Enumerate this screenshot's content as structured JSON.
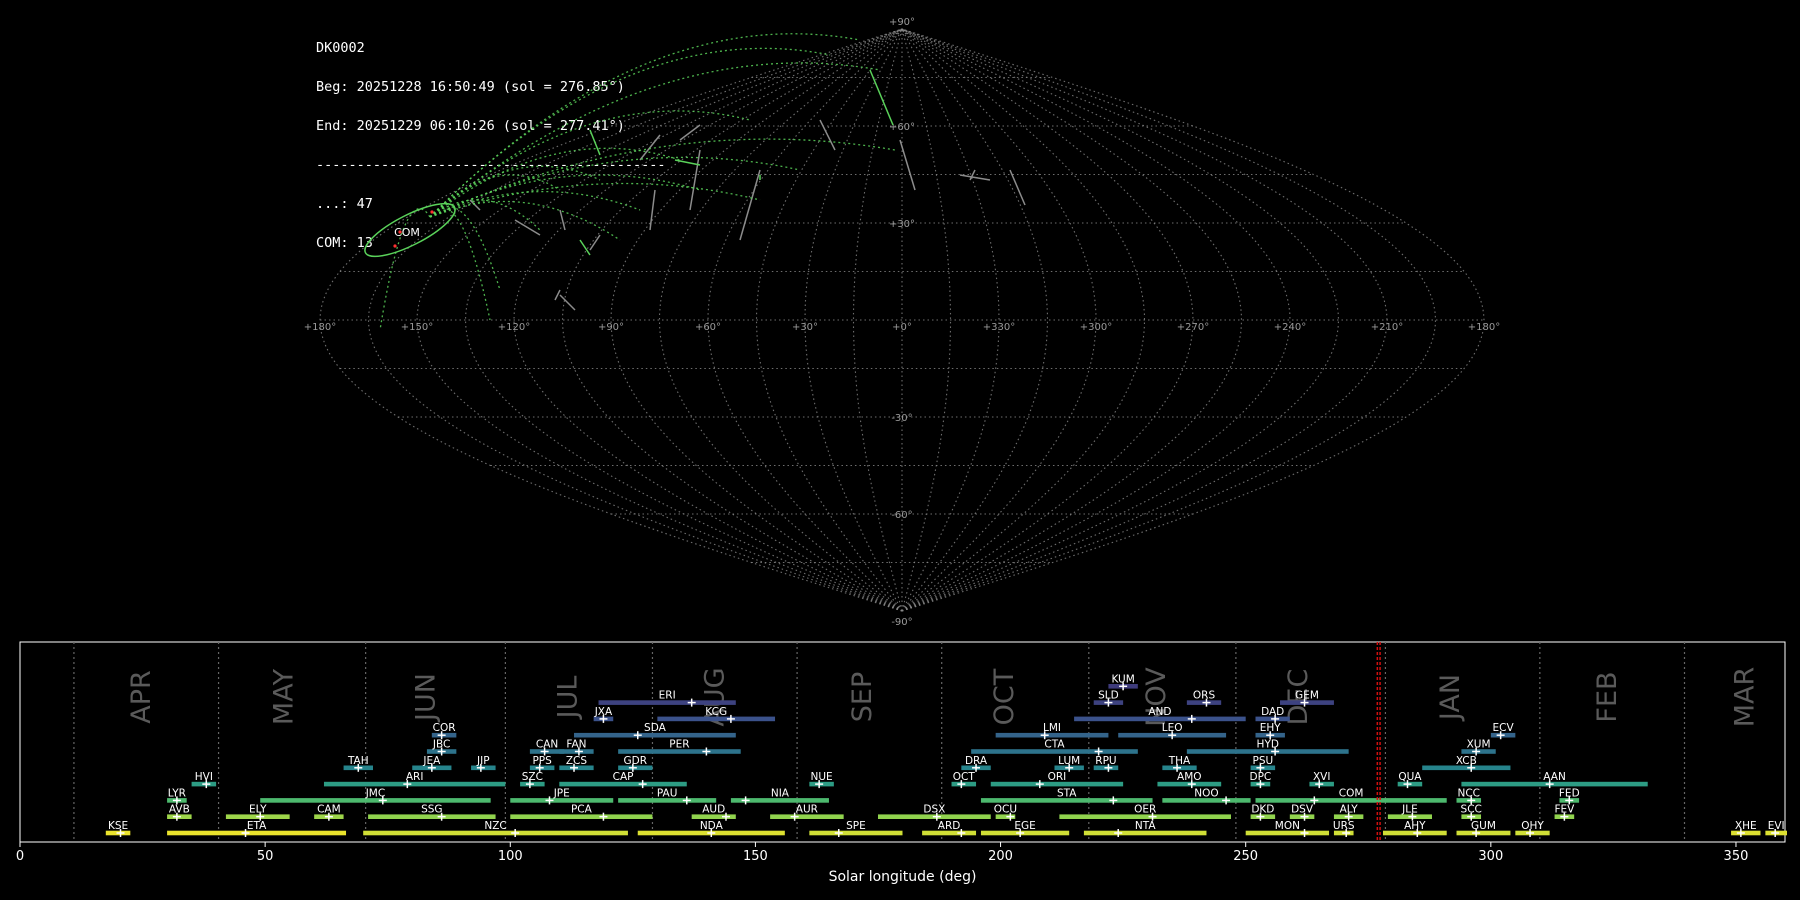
{
  "info": {
    "station": "DK0002",
    "begin": "Beg: 20251228 16:50:49 (sol = 276.85°)",
    "end": "End: 20251229 06:10:26 (sol = 277.41°)",
    "separator": "-------------------------------------------",
    "counts": [
      {
        "label": "...",
        "value": 47
      },
      {
        "label": "COM",
        "value": 13
      }
    ]
  },
  "colors": {
    "background": "#000000",
    "grid": "#8a8a8a",
    "sporadic_track": "#8c8c8c",
    "shower_track": "#5ad25a",
    "radiant_marker": "#ff3030",
    "current_sol_line": "#d01010",
    "month_label": "#5a5a5a",
    "timeline_text": "#ffffff"
  },
  "skymap": {
    "projection": "sinusoidal",
    "lon_tick_labels": [
      "+180°",
      "+150°",
      "+120°",
      "+90°",
      "+60°",
      "+30°",
      "+0°",
      "+330°",
      "+300°",
      "+270°",
      "+240°",
      "+210°",
      "+180°"
    ],
    "lat_tick_labels": [
      "+90°",
      "+60°",
      "+30°",
      "-30°",
      "-60°",
      "-90°"
    ],
    "radiant_label": "COM"
  },
  "chart_data": {
    "type": "gantt",
    "xlabel": "Solar longitude (deg)",
    "xlim": [
      0,
      360
    ],
    "xticks": [
      0,
      50,
      100,
      150,
      200,
      250,
      300,
      350
    ],
    "grid": false,
    "current_sol": [
      276.85,
      277.41
    ],
    "months": [
      {
        "name": "APR",
        "boundary": 11,
        "label_at": 25
      },
      {
        "name": "MAY",
        "boundary": 40.5,
        "label_at": 54
      },
      {
        "name": "JUN",
        "boundary": 70.5,
        "label_at": 83
      },
      {
        "name": "JUL",
        "boundary": 99,
        "label_at": 112
      },
      {
        "name": "AUG",
        "boundary": 129,
        "label_at": 142
      },
      {
        "name": "SEP",
        "boundary": 158.5,
        "label_at": 172
      },
      {
        "name": "OCT",
        "boundary": 188,
        "label_at": 201
      },
      {
        "name": "NOV",
        "boundary": 218,
        "label_at": 232
      },
      {
        "name": "DEC",
        "boundary": 248,
        "label_at": 261
      },
      {
        "name": "JAN",
        "boundary": 278.5,
        "label_at": 292
      },
      {
        "name": "FEB",
        "boundary": 310,
        "label_at": 324
      },
      {
        "name": "MAR",
        "boundary": 339.5,
        "label_at": 352
      }
    ],
    "showers": [
      {
        "code": "KSE",
        "row": 0,
        "start": 17.5,
        "end": 22.5,
        "peak": 20.5,
        "level": 0.97
      },
      {
        "code": "ETA",
        "row": 0,
        "start": 30,
        "end": 66.5,
        "peak": 46,
        "level": 0.97
      },
      {
        "code": "NZC",
        "row": 0,
        "start": 70,
        "end": 124,
        "peak": 101,
        "level": 0.93
      },
      {
        "code": "NDA",
        "row": 0,
        "start": 126,
        "end": 156,
        "peak": 141,
        "level": 0.95
      },
      {
        "code": "SPE",
        "row": 0,
        "start": 161,
        "end": 180,
        "peak": 167,
        "level": 0.93
      },
      {
        "code": "ARD",
        "row": 0,
        "start": 184,
        "end": 195,
        "peak": 192,
        "level": 0.93
      },
      {
        "code": "EGE",
        "row": 0,
        "start": 196,
        "end": 214,
        "peak": 204,
        "level": 0.93
      },
      {
        "code": "NTA",
        "row": 0,
        "start": 217,
        "end": 242,
        "peak": 224,
        "level": 0.93
      },
      {
        "code": "MON",
        "row": 0,
        "start": 250,
        "end": 267,
        "peak": 262,
        "level": 0.93
      },
      {
        "code": "URS",
        "row": 0,
        "start": 268,
        "end": 272,
        "peak": 270.5,
        "level": 0.93
      },
      {
        "code": "AHY",
        "row": 0,
        "start": 278,
        "end": 291,
        "peak": 285,
        "level": 0.93
      },
      {
        "code": "GUM",
        "row": 0,
        "start": 293,
        "end": 304,
        "peak": 297,
        "level": 0.93
      },
      {
        "code": "OHY",
        "row": 0,
        "start": 305,
        "end": 312,
        "peak": 308,
        "level": 0.93
      },
      {
        "code": "XHE",
        "row": 0,
        "start": 349,
        "end": 355,
        "peak": 351,
        "level": 0.95
      },
      {
        "code": "EVI",
        "row": 0,
        "start": 356,
        "end": 361,
        "peak": 358,
        "level": 0.95
      },
      {
        "code": "AVB",
        "row": 1,
        "start": 30,
        "end": 35,
        "peak": 32,
        "level": 0.85
      },
      {
        "code": "ELY",
        "row": 1,
        "start": 42,
        "end": 55,
        "peak": 49,
        "level": 0.85
      },
      {
        "code": "CAM",
        "row": 1,
        "start": 60,
        "end": 66,
        "peak": 63,
        "level": 0.85
      },
      {
        "code": "SSG",
        "row": 1,
        "start": 71,
        "end": 97,
        "peak": 86,
        "level": 0.83
      },
      {
        "code": "PCA",
        "row": 1,
        "start": 100,
        "end": 129,
        "peak": 119,
        "level": 0.83
      },
      {
        "code": "AUD",
        "row": 1,
        "start": 137,
        "end": 146,
        "peak": 144,
        "level": 0.83
      },
      {
        "code": "AUR",
        "row": 1,
        "start": 153,
        "end": 168,
        "peak": 158,
        "level": 0.83
      },
      {
        "code": "DSX",
        "row": 1,
        "start": 175,
        "end": 198,
        "peak": 187,
        "level": 0.83
      },
      {
        "code": "OCU",
        "row": 1,
        "start": 199,
        "end": 203,
        "peak": 202,
        "level": 0.83
      },
      {
        "code": "OER",
        "row": 1,
        "start": 212,
        "end": 247,
        "peak": 231,
        "level": 0.83
      },
      {
        "code": "DKD",
        "row": 1,
        "start": 251,
        "end": 256,
        "peak": 253,
        "level": 0.83
      },
      {
        "code": "DSV",
        "row": 1,
        "start": 259,
        "end": 264,
        "peak": 262,
        "level": 0.83
      },
      {
        "code": "ALY",
        "row": 1,
        "start": 268,
        "end": 274,
        "peak": 271,
        "level": 0.83
      },
      {
        "code": "JLE",
        "row": 1,
        "start": 279,
        "end": 288,
        "peak": 284,
        "level": 0.83
      },
      {
        "code": "SCC",
        "row": 1,
        "start": 294,
        "end": 298,
        "peak": 296,
        "level": 0.83
      },
      {
        "code": "FEV",
        "row": 1,
        "start": 313,
        "end": 317,
        "peak": 315,
        "level": 0.83
      },
      {
        "code": "LYR",
        "row": 2,
        "start": 30,
        "end": 34,
        "peak": 32,
        "level": 0.68
      },
      {
        "code": "JMC",
        "row": 2,
        "start": 49,
        "end": 96,
        "peak": 74,
        "level": 0.68
      },
      {
        "code": "JPE",
        "row": 2,
        "start": 100,
        "end": 121,
        "peak": 108,
        "level": 0.68
      },
      {
        "code": "PAU",
        "row": 2,
        "start": 122,
        "end": 142,
        "peak": 136,
        "level": 0.68
      },
      {
        "code": "NIA",
        "row": 2,
        "start": 145,
        "end": 165,
        "peak": 148,
        "level": 0.68
      },
      {
        "code": "STA",
        "row": 2,
        "start": 196,
        "end": 231,
        "peak": 223,
        "level": 0.68
      },
      {
        "code": "NOO",
        "row": 2,
        "start": 233,
        "end": 251,
        "peak": 246,
        "level": 0.68
      },
      {
        "code": "COM",
        "row": 2,
        "start": 252,
        "end": 291,
        "peak": 264,
        "level": 0.68
      },
      {
        "code": "NCC",
        "row": 2,
        "start": 293,
        "end": 298,
        "peak": 296,
        "level": 0.68
      },
      {
        "code": "FED",
        "row": 2,
        "start": 314,
        "end": 318,
        "peak": 316,
        "level": 0.68
      },
      {
        "code": "HVI",
        "row": 3,
        "start": 35,
        "end": 40,
        "peak": 38,
        "level": 0.55
      },
      {
        "code": "ARI",
        "row": 3,
        "start": 62,
        "end": 99,
        "peak": 79,
        "level": 0.55
      },
      {
        "code": "SZC",
        "row": 3,
        "start": 102,
        "end": 107,
        "peak": 104,
        "level": 0.55
      },
      {
        "code": "CAP",
        "row": 3,
        "start": 110,
        "end": 136,
        "peak": 127,
        "level": 0.55
      },
      {
        "code": "NUE",
        "row": 3,
        "start": 161,
        "end": 166,
        "peak": 163,
        "level": 0.55
      },
      {
        "code": "OCT",
        "row": 3,
        "start": 190,
        "end": 195,
        "peak": 192,
        "level": 0.55
      },
      {
        "code": "ORI",
        "row": 3,
        "start": 198,
        "end": 225,
        "peak": 208,
        "level": 0.55
      },
      {
        "code": "AMO",
        "row": 3,
        "start": 232,
        "end": 245,
        "peak": 239,
        "level": 0.55
      },
      {
        "code": "DPC",
        "row": 3,
        "start": 251,
        "end": 255,
        "peak": 253,
        "level": 0.55
      },
      {
        "code": "XVI",
        "row": 3,
        "start": 263,
        "end": 268,
        "peak": 265,
        "level": 0.55
      },
      {
        "code": "QUA",
        "row": 3,
        "start": 281,
        "end": 286,
        "peak": 283,
        "level": 0.55
      },
      {
        "code": "AAN",
        "row": 3,
        "start": 294,
        "end": 332,
        "peak": 312,
        "level": 0.55
      },
      {
        "code": "TAH",
        "row": 4,
        "start": 66,
        "end": 72,
        "peak": 69,
        "level": 0.45
      },
      {
        "code": "JEA",
        "row": 4,
        "start": 80,
        "end": 88,
        "peak": 84,
        "level": 0.45
      },
      {
        "code": "JIP",
        "row": 4,
        "start": 92,
        "end": 97,
        "peak": 94,
        "level": 0.45
      },
      {
        "code": "PPS",
        "row": 4,
        "start": 104,
        "end": 109,
        "peak": 106,
        "level": 0.45
      },
      {
        "code": "ZCS",
        "row": 4,
        "start": 110,
        "end": 117,
        "peak": 113,
        "level": 0.45
      },
      {
        "code": "GDR",
        "row": 4,
        "start": 122,
        "end": 129,
        "peak": 125,
        "level": 0.45
      },
      {
        "code": "DRA",
        "row": 4,
        "start": 192,
        "end": 198,
        "peak": 195,
        "level": 0.45
      },
      {
        "code": "LUM",
        "row": 4,
        "start": 211,
        "end": 217,
        "peak": 214,
        "level": 0.45
      },
      {
        "code": "RPU",
        "row": 4,
        "start": 219,
        "end": 224,
        "peak": 222,
        "level": 0.45
      },
      {
        "code": "THA",
        "row": 4,
        "start": 233,
        "end": 240,
        "peak": 236,
        "level": 0.45
      },
      {
        "code": "PSU",
        "row": 4,
        "start": 251,
        "end": 256,
        "peak": 253,
        "level": 0.45
      },
      {
        "code": "XCB",
        "row": 4,
        "start": 286,
        "end": 304,
        "peak": 296,
        "level": 0.45
      },
      {
        "code": "JBC",
        "row": 5,
        "start": 83,
        "end": 89,
        "peak": 86,
        "level": 0.38
      },
      {
        "code": "CAN",
        "row": 5,
        "start": 104,
        "end": 111,
        "peak": 107,
        "level": 0.38
      },
      {
        "code": "FAN",
        "row": 5,
        "start": 110,
        "end": 117,
        "peak": 114,
        "level": 0.38
      },
      {
        "code": "PER",
        "row": 5,
        "start": 122,
        "end": 147,
        "peak": 140,
        "level": 0.38
      },
      {
        "code": "CTA",
        "row": 5,
        "start": 194,
        "end": 228,
        "peak": 220,
        "level": 0.38
      },
      {
        "code": "HYD",
        "row": 5,
        "start": 238,
        "end": 271,
        "peak": 256,
        "level": 0.38
      },
      {
        "code": "XUM",
        "row": 5,
        "start": 294,
        "end": 301,
        "peak": 297,
        "level": 0.38
      },
      {
        "code": "COR",
        "row": 6,
        "start": 84,
        "end": 89,
        "peak": 86,
        "level": 0.32
      },
      {
        "code": "SDA",
        "row": 6,
        "start": 113,
        "end": 146,
        "peak": 126,
        "level": 0.32
      },
      {
        "code": "LMI",
        "row": 6,
        "start": 199,
        "end": 222,
        "peak": 209,
        "level": 0.32
      },
      {
        "code": "LEO",
        "row": 6,
        "start": 224,
        "end": 246,
        "peak": 235,
        "level": 0.32
      },
      {
        "code": "EHY",
        "row": 6,
        "start": 252,
        "end": 258,
        "peak": 255,
        "level": 0.32
      },
      {
        "code": "ECV",
        "row": 6,
        "start": 300,
        "end": 305,
        "peak": 302,
        "level": 0.32
      },
      {
        "code": "JXA",
        "row": 7,
        "start": 117,
        "end": 121,
        "peak": 119,
        "level": 0.25
      },
      {
        "code": "KCG",
        "row": 7,
        "start": 130,
        "end": 154,
        "peak": 145,
        "level": 0.25
      },
      {
        "code": "AND",
        "row": 7,
        "start": 215,
        "end": 250,
        "peak": 239,
        "level": 0.25
      },
      {
        "code": "DAD",
        "row": 7,
        "start": 252,
        "end": 259,
        "peak": 256,
        "level": 0.25
      },
      {
        "code": "ERI",
        "row": 8,
        "start": 118,
        "end": 146,
        "peak": 137,
        "level": 0.2
      },
      {
        "code": "SLD",
        "row": 8,
        "start": 219,
        "end": 225,
        "peak": 222,
        "level": 0.2
      },
      {
        "code": "ORS",
        "row": 8,
        "start": 238,
        "end": 245,
        "peak": 242,
        "level": 0.2
      },
      {
        "code": "GEM",
        "row": 8,
        "start": 257,
        "end": 268,
        "peak": 262,
        "level": 0.2
      },
      {
        "code": "KUM",
        "row": 9,
        "start": 222,
        "end": 228,
        "peak": 225,
        "level": 0.18
      }
    ]
  }
}
